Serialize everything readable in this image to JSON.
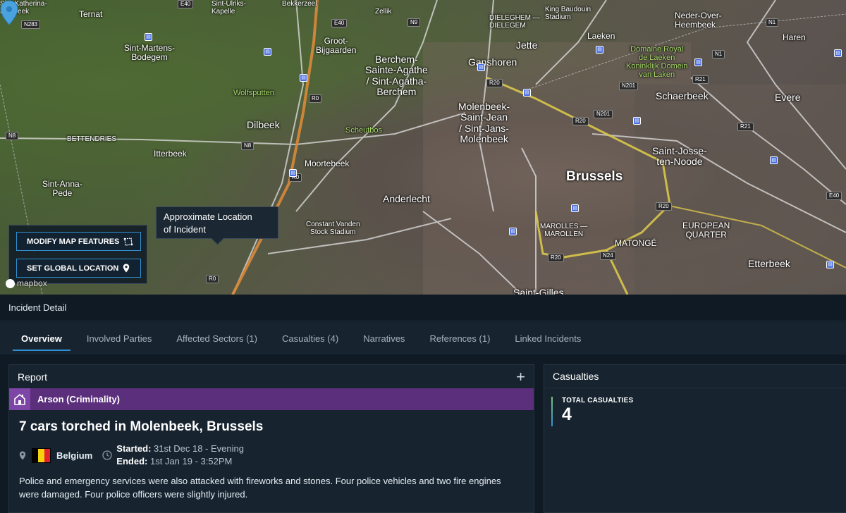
{
  "map": {
    "labels": [
      {
        "text": "Sint-Katherina-\nLombeek",
        "cls": "small"
      },
      {
        "text": "Ternat",
        "cls": "med"
      },
      {
        "text": "Sint-Ulriks-\nKapelle",
        "cls": "small"
      },
      {
        "text": "Bekkerzeel",
        "cls": "small"
      },
      {
        "text": "Zellik",
        "cls": "small"
      },
      {
        "text": "DIELEGHEM —\nDIELEGEM",
        "cls": "small"
      },
      {
        "text": "King Baudouin\nStadium",
        "cls": "small"
      },
      {
        "text": "Neder-Over-\nHeembeek",
        "cls": "med"
      },
      {
        "text": "Sint-Martens-\nBodegem",
        "cls": "med"
      },
      {
        "text": "Groot-\nBijgaarden",
        "cls": "med"
      },
      {
        "text": "Berchem-\nSainte-Agathe\n/ Sint-Agatha-\nBerchem",
        "cls": ""
      },
      {
        "text": "Ganshoren",
        "cls": ""
      },
      {
        "text": "Jette",
        "cls": ""
      },
      {
        "text": "Laeken",
        "cls": "med"
      },
      {
        "text": "Haren",
        "cls": "med"
      },
      {
        "text": "Domaine Royal\nde Laeken\nKoninklijk Domein\nvan Laken",
        "cls": "green"
      },
      {
        "text": "Wolfsputten",
        "cls": "green"
      },
      {
        "text": "Molenbeek-\nSaint-Jean\n/ Sint-Jans-\nMolenbeek",
        "cls": ""
      },
      {
        "text": "Schaerbeek",
        "cls": ""
      },
      {
        "text": "Evere",
        "cls": ""
      },
      {
        "text": "Dilbeek",
        "cls": ""
      },
      {
        "text": "Scheutbos",
        "cls": "green"
      },
      {
        "text": "BETTENDRIES",
        "cls": "small"
      },
      {
        "text": "Itterbeek",
        "cls": "med"
      },
      {
        "text": "Moortebeek",
        "cls": "med"
      },
      {
        "text": "Brussels",
        "cls": "big"
      },
      {
        "text": "Saint-Josse-\nten-Noode",
        "cls": ""
      },
      {
        "text": "Sint-Anna-\nPede",
        "cls": "med"
      },
      {
        "text": "Anderlecht",
        "cls": ""
      },
      {
        "text": "Constant Vanden\nStock Stadium",
        "cls": "small"
      },
      {
        "text": "MAROLLES —\nMAROLLEN",
        "cls": "small"
      },
      {
        "text": "MATONGÉ",
        "cls": "med"
      },
      {
        "text": "EUROPEAN\nQUARTER",
        "cls": "med"
      },
      {
        "text": "Etterbeek",
        "cls": ""
      },
      {
        "text": "Saint-Gilles",
        "cls": ""
      }
    ],
    "road_badges": [
      "N283",
      "E40",
      "E40",
      "N9",
      "N1",
      "R0",
      "R20",
      "N201",
      "R21",
      "N1",
      "R20",
      "N201",
      "R21",
      "N8",
      "N8",
      "R0",
      "R20",
      "N24",
      "R20",
      "E40",
      "R0"
    ],
    "tooltip": "Approximate Location\nof Incident",
    "modify_button": "MODIFY MAP FEATURES",
    "global_location_button": "SET GLOBAL LOCATION",
    "attribution": "mapbox"
  },
  "incident": {
    "header": "Incident Detail",
    "tabs": [
      {
        "label": "Overview",
        "active": true
      },
      {
        "label": "Involved Parties",
        "active": false
      },
      {
        "label": "Affected Sectors (1)",
        "active": false
      },
      {
        "label": "Casualties (4)",
        "active": false
      },
      {
        "label": "Narratives",
        "active": false
      },
      {
        "label": "References (1)",
        "active": false
      },
      {
        "label": "Linked Incidents",
        "active": false
      }
    ]
  },
  "report": {
    "heading": "Report",
    "category": "Arson (Criminality)",
    "category_color": "#5b2f7c",
    "title": "7 cars torched in Molenbeek, Brussels",
    "country": "Belgium",
    "started_label": "Started:",
    "started_value": "31st Dec 18 - Evening",
    "ended_label": "Ended:",
    "ended_value": "1st Jan 19 - 3:52PM",
    "description": "Police and emergency services were also attacked with fireworks and stones. Four police vehicles and two fire engines were damaged. Four police officers were slightly injured."
  },
  "casualties": {
    "heading": "Casualties",
    "total_label": "TOTAL CASUALTIES",
    "total_value": "4"
  },
  "colors": {
    "accent": "#2f8fd0",
    "panel": "#172430",
    "background": "#0f1a24"
  }
}
